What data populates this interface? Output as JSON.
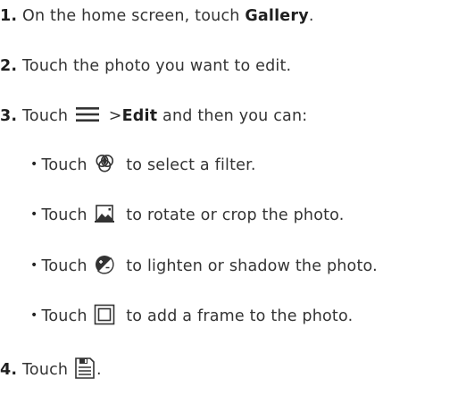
{
  "steps": [
    {
      "num": "1.",
      "text_before": "On the home screen, touch ",
      "bold": "Gallery",
      "text_after": "."
    },
    {
      "num": "2.",
      "text": "Touch the photo you want to edit."
    },
    {
      "num": "3.",
      "text_before": "Touch ",
      "gt": ">",
      "bold": "Edit",
      "text_after": " and then you can:",
      "icon": "menu-icon"
    },
    {
      "num": "4.",
      "text_before": "Touch ",
      "text_after": ".",
      "icon": "save-icon"
    }
  ],
  "sub_items": [
    {
      "text_before": "Touch ",
      "text_after": " to select a filter.",
      "icon": "filter-icon"
    },
    {
      "text_before": "Touch ",
      "text_after": " to rotate or crop the photo.",
      "icon": "crop-rotate-icon"
    },
    {
      "text_before": "Touch ",
      "text_after": " to lighten or shadow the photo.",
      "icon": "exposure-icon"
    },
    {
      "text_before": "Touch ",
      "text_after": " to add a frame to the photo.",
      "icon": "frame-icon"
    }
  ],
  "bullet_char": "•"
}
